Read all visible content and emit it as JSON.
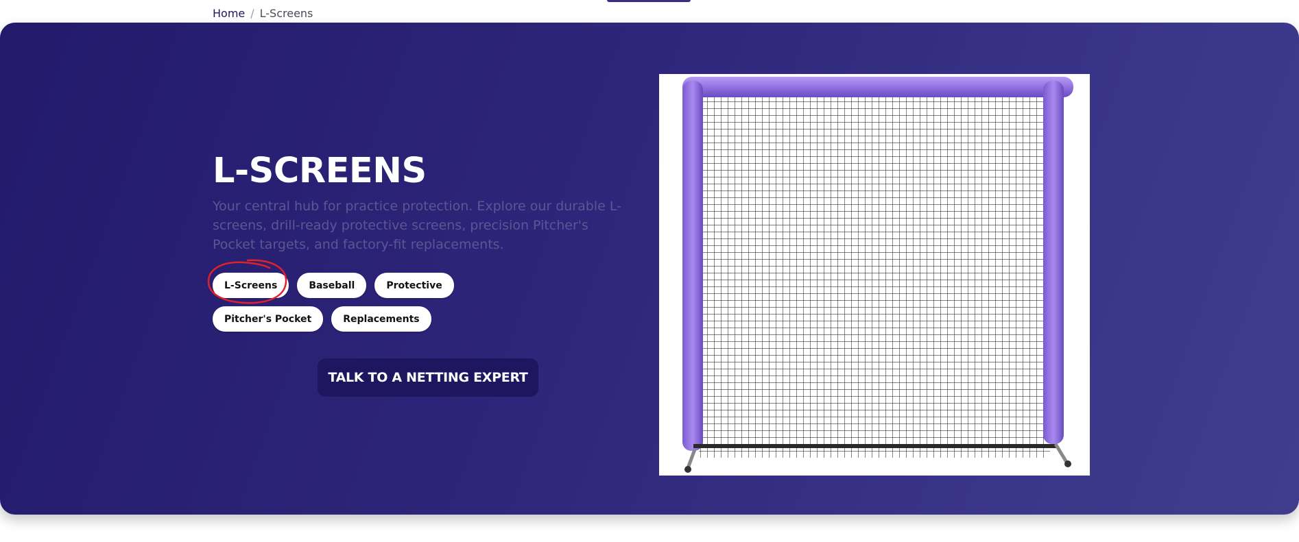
{
  "breadcrumb": {
    "home": "Home",
    "separator": "/",
    "current": "L-Screens"
  },
  "hero": {
    "title": "L-SCREENS",
    "description": "Your central hub for practice protection. Explore our durable L-screens, drill-ready protective screens, precision Pitcher's Pocket targets, and factory-fit replacements.",
    "chips": [
      "L-Screens",
      "Baseball",
      "Protective",
      "Pitcher's Pocket",
      "Replacements"
    ],
    "cta_label": "TALK TO A NETTING EXPERT",
    "highlighted_chip": "L-Screens"
  },
  "colors": {
    "hero_gradient_start": "#231a6c",
    "hero_gradient_end": "#403d8e",
    "cta_background": "#1f1660",
    "frame_padding_color": "#9b7be0",
    "annotation_color": "#e0202a"
  },
  "icons": {
    "product_image": "l-screen-net-image"
  }
}
